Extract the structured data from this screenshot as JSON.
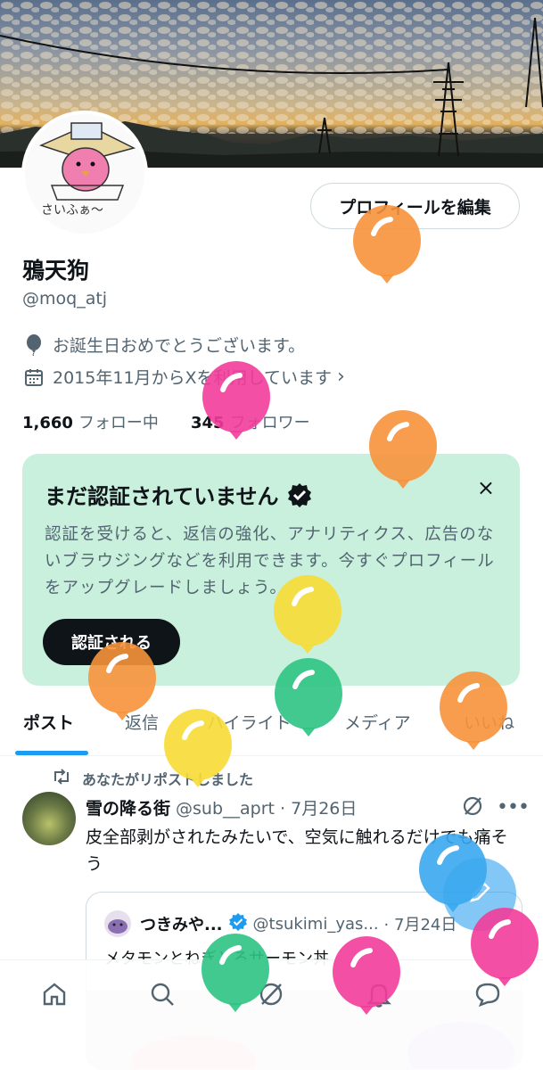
{
  "profile": {
    "edit_button": "プロフィールを編集",
    "display_name": "鴉天狗",
    "handle": "@moq_atj",
    "birthday_text": "お誕生日おめでとうございます。",
    "joined_text": "2015年11月からXを利用しています",
    "following_count": "1,660",
    "following_label": "フォロー中",
    "followers_count": "345",
    "followers_label": "フォロワー",
    "avatar_caption": "さいふぁ〜"
  },
  "verify_card": {
    "title": "まだ認証されていません",
    "body": "認証を受けると、返信の強化、アナリティクス、広告のないブラウジングなどを利用できます。今すぐプロフィールをアップグレードしましょう。",
    "cta": "認証される",
    "close": "×"
  },
  "tabs": [
    {
      "label": "ポスト",
      "active": true
    },
    {
      "label": "返信",
      "active": false
    },
    {
      "label": "ハイライト",
      "active": false
    },
    {
      "label": "メディア",
      "active": false
    },
    {
      "label": "いいね",
      "active": false
    }
  ],
  "post": {
    "repost_label": "あなたがリポストしました",
    "author": "雪の降る街",
    "meta": "@sub__aprt · 7月26日",
    "text": "皮全部剥がされたみたいで、空気に触れるだけでも痛そう",
    "quote": {
      "author": "つきみや...",
      "meta": "@tsukimi_yas...",
      "date": "· 7月24日",
      "text": "メタモンとねぎとろサーモン丼"
    }
  },
  "bottom_nav": [
    "home-icon",
    "search-icon",
    "grok-icon",
    "notifications-icon",
    "messages-icon"
  ],
  "colors": {
    "accent": "#1d9bf0",
    "card_bg": "#c8f0dc",
    "balloon_orange": "#f7923b",
    "balloon_pink": "#f23c9a",
    "balloon_yellow": "#f7dc35",
    "balloon_green": "#2ec383",
    "balloon_blue": "#3aa7ee"
  }
}
